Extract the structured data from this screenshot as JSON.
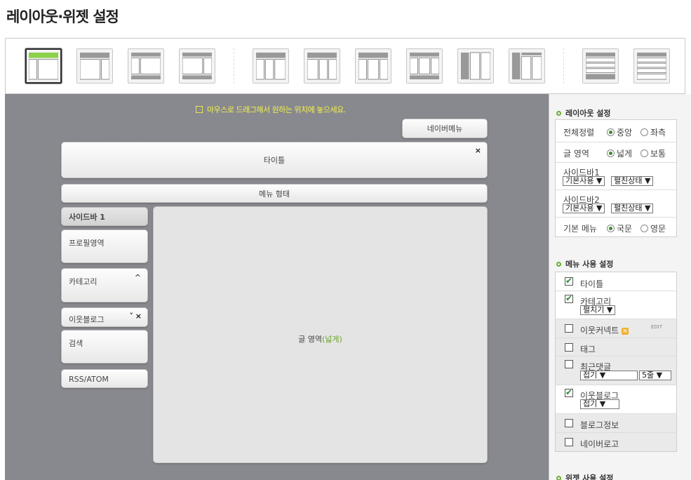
{
  "page": {
    "title": "레이아웃·위젯 설정"
  },
  "layouts": [
    {
      "id": "l1",
      "selected": true
    },
    {
      "id": "l2"
    },
    {
      "id": "l3"
    },
    {
      "id": "l4"
    },
    {
      "id": "l5"
    },
    {
      "id": "l6"
    },
    {
      "id": "l7"
    },
    {
      "id": "l8"
    },
    {
      "id": "l9"
    },
    {
      "id": "l10"
    },
    {
      "id": "l11"
    },
    {
      "id": "l12"
    }
  ],
  "canvas": {
    "hint": "마우스로 드래그해서 원하는 위치에 놓으세요.",
    "naver_menu": "네이버메뉴",
    "title_box": "타이틀",
    "menu_box": "메뉴 형태",
    "sidebar_header": "사이드바 1",
    "widgets": [
      "프로필영역",
      "카테고리",
      "이웃블로그",
      "검색",
      "RSS/ATOM"
    ],
    "content_label_prefix": "글 영역",
    "content_label_accent": "(넓게)",
    "close_glyph": "×",
    "up_glyph": "^",
    "down_glyph": "˅"
  },
  "sidebar": {
    "layout_section": {
      "title": "레이아웃 설정",
      "rows": {
        "align": {
          "label": "전체정렬",
          "opt1": "중앙",
          "opt2": "좌측",
          "selected": 1
        },
        "content": {
          "label": "글 영역",
          "opt1": "넓게",
          "opt2": "보통",
          "selected": 1
        },
        "sidebar1": {
          "label": "사이드바1",
          "sel1": "기본사용 ▼",
          "sel2": "펼친상태 ▼"
        },
        "sidebar2": {
          "label": "사이드바2",
          "sel1": "기본사용 ▼",
          "sel2": "펼친상태 ▼"
        },
        "menu": {
          "label": "기본 메뉴",
          "opt1": "국문",
          "opt2": "영문",
          "selected": 1
        }
      }
    },
    "menu_section": {
      "title": "메뉴 사용 설정",
      "items": {
        "title": {
          "label": "타이틀",
          "checked": true
        },
        "category": {
          "label": "카테고리",
          "checked": true,
          "select": "펼치기 ▼"
        },
        "neighbor_comment": {
          "label": "이웃커넥트",
          "checked": false,
          "badge": "N",
          "edit": "EDIT"
        },
        "tag": {
          "label": "태그",
          "checked": false
        },
        "recent_comments": {
          "label": "최근댓글",
          "checked": false,
          "select1": "접기 ▼",
          "select2": "5줄 ▼"
        },
        "neighbor_blog": {
          "label": "이웃블로그",
          "checked": true,
          "select": "접기 ▼"
        },
        "blog_info": {
          "label": "블로그정보",
          "checked": false
        },
        "naver_logo": {
          "label": "네이버로고",
          "checked": false
        }
      }
    },
    "widget_section": {
      "title": "위젯 사용 설정"
    }
  },
  "colors": {
    "canvas_bg": "#88898f",
    "accent_green": "#6ab02e",
    "hint_yellow": "#f4f14b"
  }
}
